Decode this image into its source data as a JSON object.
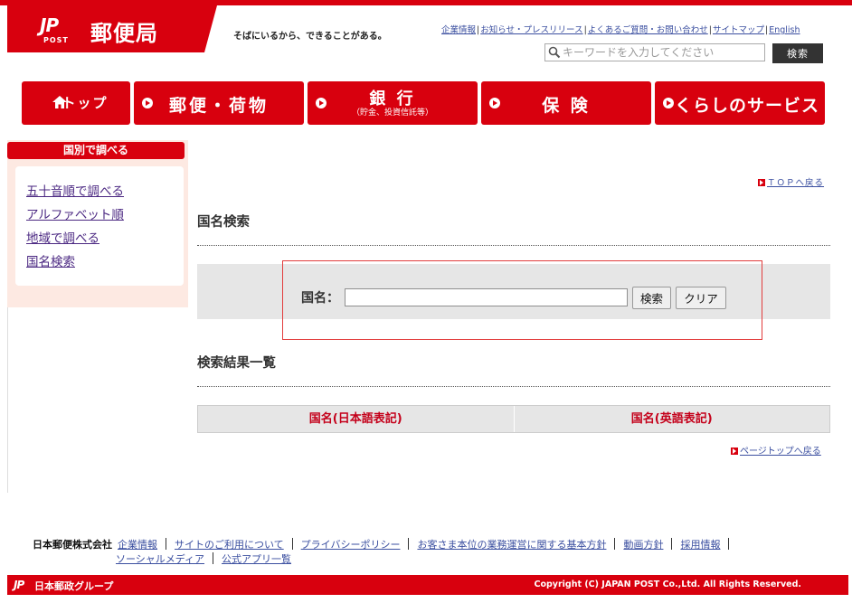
{
  "header": {
    "logo_mark": "JP",
    "logo_post": "POST",
    "logo_name": "郵便局",
    "tagline": "そばにいるから、できることがある。",
    "util_links": [
      "企業情報",
      "お知らせ・プレスリリース",
      "よくあるご質問・お問い合わせ",
      "サイトマップ",
      "English"
    ],
    "search_placeholder": "キーワードを入力してください",
    "search_button": "検索"
  },
  "nav": {
    "home": "トップ",
    "mail": "郵便・荷物",
    "bank": "銀 行",
    "bank_sub": "（貯金、投資信託等）",
    "insurance": "保 険",
    "life": "くらしのサービス"
  },
  "sidebar": {
    "title": "国別で調べる",
    "items": [
      "五十音順で調べる",
      "アルファベット順",
      "地域で調べる",
      "国名検索"
    ]
  },
  "main": {
    "top_back": "ＴＯＰへ戻る",
    "search_heading": "国名検索",
    "country_label": "国名：",
    "country_value": "",
    "search_button": "検索",
    "clear_button": "クリア",
    "results_heading": "検索結果一覧",
    "columns": [
      "国名(日本語表記)",
      "国名(英語表記)"
    ],
    "page_top": "ページトップへ戻る"
  },
  "footer": {
    "company": "日本郵便株式会社",
    "links_row1": [
      "企業情報",
      "サイトのご利用について",
      "プライバシーポリシー",
      "お客さま本位の業務運営に関する基本方針",
      "動画方針",
      "採用情報"
    ],
    "links_row2": [
      "ソーシャルメディア",
      "公式アプリ一覧"
    ],
    "group_logo": "JP",
    "group": "日本郵政グループ",
    "copyright": "Copyright (C) JAPAN POST Co.,Ltd.  All Rights Reserved."
  },
  "colors": {
    "brand_red": "#d8000e",
    "link": "#3b4fa0",
    "visited": "#4b2882"
  }
}
